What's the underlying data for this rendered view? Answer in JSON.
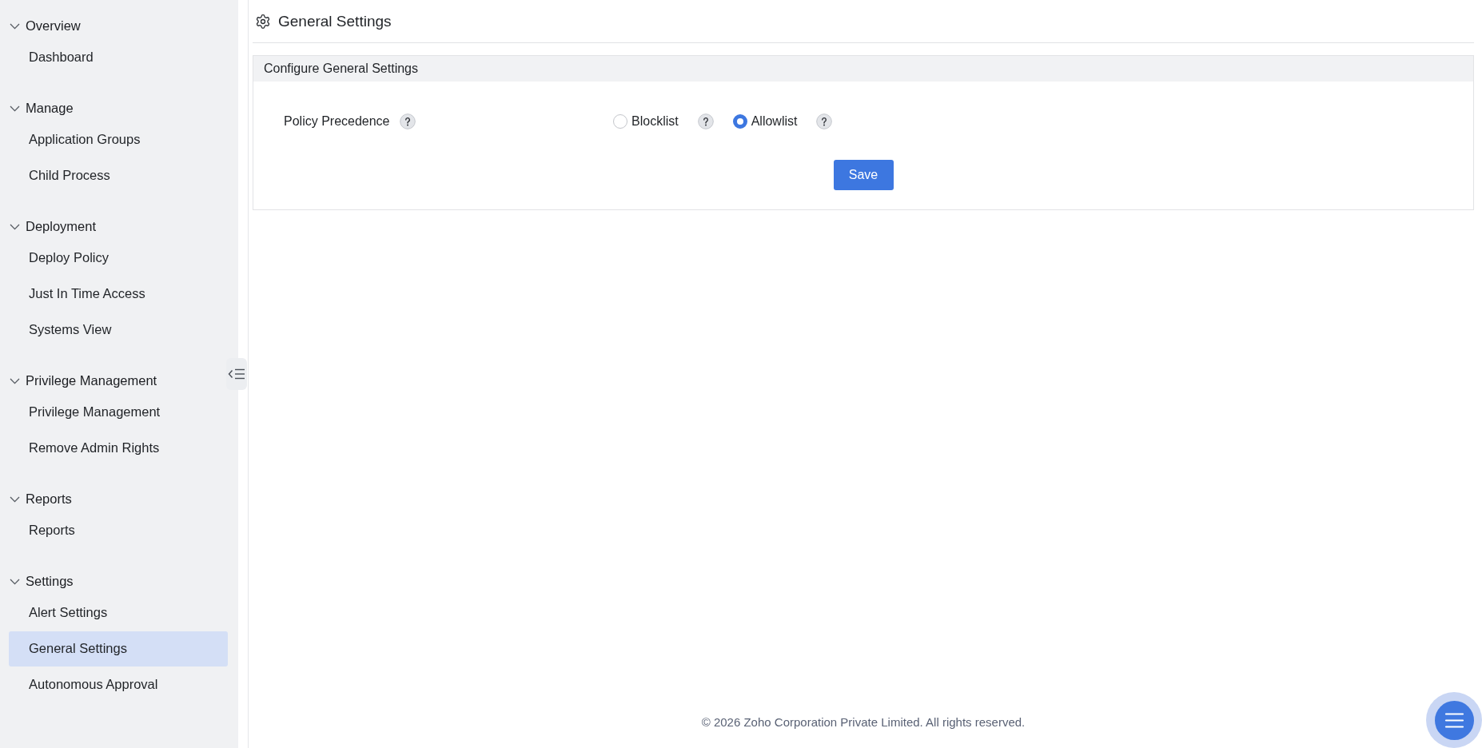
{
  "sidebar": {
    "sections": [
      {
        "title": "Overview",
        "expanded": true,
        "items": [
          {
            "label": "Dashboard",
            "selected": false
          }
        ]
      },
      {
        "title": "Manage",
        "expanded": true,
        "items": [
          {
            "label": "Application Groups",
            "selected": false
          },
          {
            "label": "Child Process",
            "selected": false
          }
        ]
      },
      {
        "title": "Deployment",
        "expanded": true,
        "items": [
          {
            "label": "Deploy Policy",
            "selected": false
          },
          {
            "label": "Just In Time Access",
            "selected": false
          },
          {
            "label": "Systems View",
            "selected": false
          }
        ]
      },
      {
        "title": "Privilege Management",
        "expanded": true,
        "items": [
          {
            "label": "Privilege Management",
            "selected": false
          },
          {
            "label": "Remove Admin Rights",
            "selected": false
          }
        ]
      },
      {
        "title": "Reports",
        "expanded": true,
        "items": [
          {
            "label": "Reports",
            "selected": false
          }
        ]
      },
      {
        "title": "Settings",
        "expanded": true,
        "items": [
          {
            "label": "Alert Settings",
            "selected": false
          },
          {
            "label": "General Settings",
            "selected": true
          },
          {
            "label": "Autonomous Approval",
            "selected": false
          }
        ]
      }
    ]
  },
  "page": {
    "title": "General Settings"
  },
  "panel": {
    "title": "Configure General Settings",
    "fields": [
      {
        "label": "Policy Precedence",
        "options": [
          {
            "label": "Blocklist",
            "selected": false
          },
          {
            "label": "Allowlist",
            "selected": true
          }
        ]
      }
    ],
    "save_button": {
      "label": "Save"
    }
  },
  "footer": {
    "text": "© 2026 Zoho Corporation Private Limited. All rights reserved."
  }
}
